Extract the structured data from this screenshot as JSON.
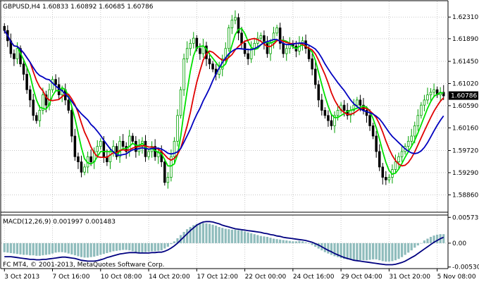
{
  "main_title": "GBPUSD,H4  1.60833 1.60892 1.60685 1.60786",
  "current_price_label": "1.60786",
  "macd_title": "MACD(12,26,9) 0.001997 0.001483",
  "copyright": "FC MT4, © 2001-2013, MetaQuotes Software Corp.",
  "colors": {
    "background": "#ffffff",
    "grid": "#c8c8c8",
    "bull_candle": "#00a000",
    "bear_candle": "#000000",
    "ma_fast": "#00e000",
    "ma_mid": "#e00000",
    "ma_slow": "#0000c0",
    "macd_hist": "#8fbcbc",
    "macd_signal": "#000080",
    "price_box": "#000000",
    "price_text": "#ffffff"
  },
  "chart_data": [
    {
      "type": "candlestick",
      "title": "GBPUSD,H4",
      "ohlc_header": {
        "open": 1.60833,
        "high": 1.60892,
        "low": 1.60685,
        "close": 1.60786
      },
      "ylim": [
        1.5855,
        1.626
      ],
      "y_ticks": [
        "1.62310",
        "1.61890",
        "1.61450",
        "1.61020",
        "1.60590",
        "1.60160",
        "1.59720",
        "1.59290",
        "1.58860"
      ],
      "y_tick_values": [
        1.6231,
        1.6189,
        1.6145,
        1.6102,
        1.6059,
        1.6016,
        1.5972,
        1.5929,
        1.5886
      ],
      "x_ticks": [
        "3 Oct 2013",
        "7 Oct 16:00",
        "10 Oct 08:00",
        "14 Oct 20:00",
        "17 Oct 12:00",
        "22 Oct 00:00",
        "24 Oct 16:00",
        "29 Oct 04:00",
        "31 Oct 20:00",
        "5 Nov 08:00"
      ],
      "close_series": [
        1.6205,
        1.6185,
        1.616,
        1.615,
        1.617,
        1.614,
        1.612,
        1.609,
        1.607,
        1.604,
        1.603,
        1.605,
        1.608,
        1.606,
        1.609,
        1.611,
        1.61,
        1.608,
        1.609,
        1.607,
        1.605,
        1.6,
        1.596,
        1.595,
        1.593,
        1.594,
        1.596,
        1.595,
        1.597,
        1.598,
        1.599,
        1.596,
        1.595,
        1.597,
        1.598,
        1.596,
        1.599,
        1.598,
        1.597,
        1.6,
        1.599,
        1.597,
        1.598,
        1.599,
        1.596,
        1.597,
        1.598,
        1.596,
        1.597,
        1.595,
        1.591,
        1.592,
        1.596,
        1.599,
        1.604,
        1.609,
        1.615,
        1.617,
        1.618,
        1.619,
        1.617,
        1.616,
        1.6175,
        1.615,
        1.614,
        1.613,
        1.612,
        1.613,
        1.615,
        1.617,
        1.621,
        1.6225,
        1.623,
        1.62,
        1.618,
        1.616,
        1.615,
        1.617,
        1.618,
        1.619,
        1.6195,
        1.618,
        1.616,
        1.618,
        1.62,
        1.621,
        1.618,
        1.616,
        1.617,
        1.618,
        1.6175,
        1.6165,
        1.618,
        1.6185,
        1.617,
        1.615,
        1.613,
        1.61,
        1.607,
        1.605,
        1.604,
        1.603,
        1.602,
        1.604,
        1.605,
        1.606,
        1.605,
        1.604,
        1.605,
        1.606,
        1.607,
        1.606,
        1.605,
        1.604,
        1.602,
        1.6,
        1.597,
        1.594,
        1.592,
        1.5915,
        1.592,
        1.5935,
        1.595,
        1.596,
        1.597,
        1.598,
        1.599,
        1.6,
        1.602,
        1.604,
        1.606,
        1.607,
        1.608,
        1.6085,
        1.609,
        1.608,
        1.6085,
        1.6078
      ]
    },
    {
      "type": "bar+line",
      "title": "MACD(12,26,9)",
      "ylim": [
        -0.0055,
        0.0061
      ],
      "y_ticks": [
        "0.005739",
        "0.00",
        "-0.005304"
      ],
      "y_tick_values": [
        0.005739,
        0.0,
        -0.005304
      ],
      "series": [
        {
          "name": "MACD",
          "kind": "histogram",
          "values": [
            -0.002,
            -0.0021,
            -0.0022,
            -0.0023,
            -0.0024,
            -0.0025,
            -0.0026,
            -0.0026,
            -0.0027,
            -0.0027,
            -0.0028,
            -0.0028,
            -0.0027,
            -0.0026,
            -0.0025,
            -0.0023,
            -0.0021,
            -0.002,
            -0.002,
            -0.0021,
            -0.0023,
            -0.0025,
            -0.0027,
            -0.0029,
            -0.0031,
            -0.0032,
            -0.0032,
            -0.0031,
            -0.003,
            -0.0028,
            -0.0026,
            -0.0024,
            -0.0022,
            -0.002,
            -0.0018,
            -0.0017,
            -0.0016,
            -0.0015,
            -0.0015,
            -0.0016,
            -0.0018,
            -0.002,
            -0.0021,
            -0.0021,
            -0.002,
            -0.0019,
            -0.0018,
            -0.0018,
            -0.0017,
            -0.0016,
            -0.0012,
            -0.0008,
            -0.0002,
            0.0004,
            0.0011,
            0.0018,
            0.0025,
            0.0031,
            0.0036,
            0.004,
            0.0043,
            0.0044,
            0.0045,
            0.0044,
            0.0043,
            0.0041,
            0.0039,
            0.0036,
            0.0034,
            0.0032,
            0.0031,
            0.003,
            0.003,
            0.0029,
            0.0028,
            0.0026,
            0.0024,
            0.0022,
            0.002,
            0.0018,
            0.0016,
            0.0015,
            0.0014,
            0.0012,
            0.001,
            0.0009,
            0.0008,
            0.0007,
            0.0006,
            0.0005,
            0.0004,
            0.0004,
            0.0005,
            0.0004,
            0.0002,
            -0.0001,
            -0.0004,
            -0.0008,
            -0.0012,
            -0.0016,
            -0.002,
            -0.0023,
            -0.0026,
            -0.0029,
            -0.0031,
            -0.0033,
            -0.0035,
            -0.0036,
            -0.0037,
            -0.0037,
            -0.0038,
            -0.0038,
            -0.0038,
            -0.0038,
            -0.0037,
            -0.0036,
            -0.0036,
            -0.0038,
            -0.004,
            -0.0041,
            -0.0041,
            -0.004,
            -0.0038,
            -0.0035,
            -0.0031,
            -0.0026,
            -0.0021,
            -0.0016,
            -0.001,
            -0.0005,
            0.0,
            0.0006,
            0.001,
            0.0014,
            0.0017,
            0.0019,
            0.002,
            0.002
          ]
        },
        {
          "name": "Signal",
          "kind": "line",
          "values": [
            -0.003,
            -0.003,
            -0.003,
            -0.0031,
            -0.0032,
            -0.0033,
            -0.0034,
            -0.0035,
            -0.0036,
            -0.0036,
            -0.0037,
            -0.0037,
            -0.0036,
            -0.0036,
            -0.0035,
            -0.0034,
            -0.0033,
            -0.0032,
            -0.0031,
            -0.0031,
            -0.0032,
            -0.0033,
            -0.0034,
            -0.0036,
            -0.0038,
            -0.0039,
            -0.004,
            -0.004,
            -0.004,
            -0.0039,
            -0.0037,
            -0.0035,
            -0.0032,
            -0.003,
            -0.0028,
            -0.0026,
            -0.0024,
            -0.0023,
            -0.0022,
            -0.0021,
            -0.0021,
            -0.0021,
            -0.0022,
            -0.0022,
            -0.0022,
            -0.0022,
            -0.0021,
            -0.0021,
            -0.002,
            -0.002,
            -0.0018,
            -0.0015,
            -0.0011,
            -0.0006,
            0.0,
            0.0007,
            0.0014,
            0.0021,
            0.0028,
            0.0034,
            0.004,
            0.0044,
            0.0047,
            0.0048,
            0.0048,
            0.0047,
            0.0045,
            0.0043,
            0.004,
            0.0038,
            0.0036,
            0.0034,
            0.0032,
            0.0031,
            0.003,
            0.0029,
            0.0028,
            0.0027,
            0.0026,
            0.0025,
            0.0024,
            0.0022,
            0.0021,
            0.0019,
            0.0018,
            0.0016,
            0.0015,
            0.0013,
            0.0012,
            0.0011,
            0.001,
            0.0009,
            0.0008,
            0.0007,
            0.0006,
            0.0004,
            0.0002,
            -0.0001,
            -0.0004,
            -0.0008,
            -0.0012,
            -0.0016,
            -0.0019,
            -0.0023,
            -0.0026,
            -0.0029,
            -0.0032,
            -0.0034,
            -0.0036,
            -0.0038,
            -0.0039,
            -0.004,
            -0.0041,
            -0.0042,
            -0.0043,
            -0.0044,
            -0.0045,
            -0.0046,
            -0.0047,
            -0.0048,
            -0.0048,
            -0.0048,
            -0.0047,
            -0.0045,
            -0.0043,
            -0.004,
            -0.0036,
            -0.0032,
            -0.0028,
            -0.0023,
            -0.0018,
            -0.0013,
            -0.0008,
            -0.0003,
            0.0002,
            0.0006,
            0.001,
            0.0013
          ]
        }
      ]
    }
  ]
}
